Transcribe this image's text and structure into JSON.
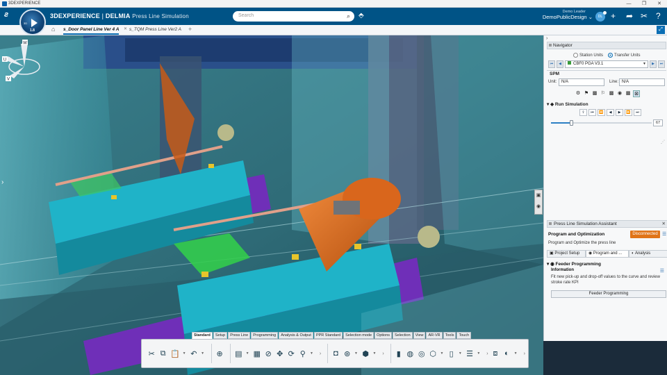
{
  "os_window": {
    "title": "3DEXPERIENCE",
    "controls": [
      "—",
      "❐",
      "✕"
    ]
  },
  "app_header": {
    "brand_bold": "3DEXPERIENCE",
    "brand_sep": " | ",
    "brand_product": "DELMIA",
    "app_name": "Press Line Simulation",
    "compass_version": "1.8",
    "compass_number": "3D",
    "search_placeholder": "Search",
    "user_role": "Demo Leader",
    "user_space": "DemoPublicDesign",
    "avatar_initials": "DL"
  },
  "tabs": [
    {
      "label": "s_Door Panel Line Ver 4 A",
      "active": true
    },
    {
      "label": "s_TQM Press Line Ver2 A",
      "active": false
    }
  ],
  "action_bar": {
    "tabs": [
      {
        "label": "Standard",
        "active": true
      },
      {
        "label": "Setup",
        "active": false
      },
      {
        "label": "Press Line",
        "active": false
      },
      {
        "label": "Programming",
        "active": false
      },
      {
        "label": "Analysis & Output",
        "active": false
      },
      {
        "label": "PPR Standard",
        "active": false
      },
      {
        "label": "Selection mode",
        "active": false
      },
      {
        "label": "Options",
        "active": false
      },
      {
        "label": "Selection",
        "active": false
      },
      {
        "label": "View",
        "active": false
      },
      {
        "label": "AR-VR",
        "active": false
      },
      {
        "label": "Tools",
        "active": false
      },
      {
        "label": "Touch",
        "active": false
      }
    ]
  },
  "navigator": {
    "title": "Navigator",
    "radio_station": "Station Units",
    "radio_transfer": "Transfer Units",
    "selected_radio": "transfer",
    "program_combo": "CBF0 PGA V3.1",
    "spm_label": "SPM",
    "unit_label": "Unit:",
    "unit_value": "N/A",
    "line_label": "Line:",
    "line_value": "N/A",
    "run_simulation_label": "Run Simulation",
    "slider_value": "67",
    "slider_fraction": 0.2
  },
  "assistant": {
    "title": "Press Line Simulation Assistant",
    "section_title": "Program and Optimization",
    "status": "Disconnected",
    "status_color": "#e07418",
    "section_subtitle": "Program and Optimize the press line",
    "tabs": [
      {
        "label": "Project Setup",
        "active": false
      },
      {
        "label": "Program and ...",
        "active": true
      },
      {
        "label": "Analysis",
        "active": false
      }
    ],
    "feeder_section": "Feeder Programming",
    "info_title": "Information",
    "info_text": "Fit new pick-up and drop-off values to the curve and review stroke rate KPI",
    "feeder_button": "Feeder Programming"
  },
  "triad": {
    "labels": [
      "W",
      "U",
      "V"
    ]
  },
  "colors": {
    "header_bg": "#005386",
    "accent": "#0a6eb4",
    "viewport_teal": "#3d8a96",
    "machine_cyan": "#1fb3c8",
    "robot_orange": "#d9661c",
    "base_purple": "#6f2fb8"
  }
}
